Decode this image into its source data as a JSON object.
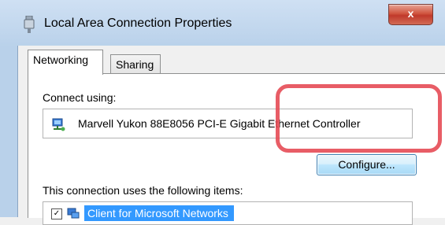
{
  "window": {
    "title": "Local Area Connection Properties",
    "close_label": "x",
    "accent_color": "#c0392b"
  },
  "tabs": [
    {
      "label": "Networking",
      "active": true
    },
    {
      "label": "Sharing",
      "active": false
    }
  ],
  "networking": {
    "connect_using_label": "Connect using:",
    "adapter_name": "Marvell Yukon 88E8056 PCI-E Gigabit Ethernet Controller",
    "adapter_icon": "network-adapter-icon",
    "configure_label": "Configure...",
    "items_label": "This connection uses the following items:",
    "items": [
      {
        "label": "Client for Microsoft Networks",
        "checked": true,
        "selected": true
      }
    ]
  },
  "highlight_color": "#e64b55"
}
